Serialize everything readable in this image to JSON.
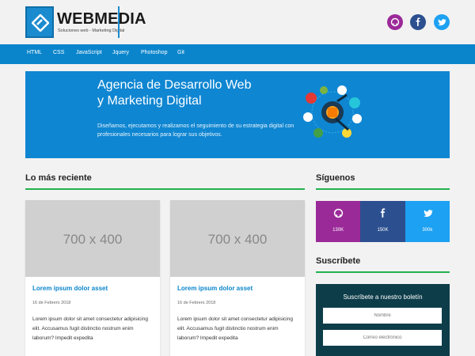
{
  "brand": {
    "name": "WEBMEDIA",
    "tagline": "Soluciones web - Marketing Digital",
    "color": "#1b8bcf"
  },
  "header_social": [
    {
      "icon": "github-icon",
      "color": "#9b2a99"
    },
    {
      "icon": "facebook-icon",
      "color": "#2c4f8f"
    },
    {
      "icon": "twitter-icon",
      "color": "#1da1f2"
    }
  ],
  "nav": {
    "items": [
      "HTML",
      "CSS",
      "JavaScript",
      "Jquery",
      "Photoshop",
      "Git"
    ],
    "color": "#0a85cc"
  },
  "hero": {
    "title_line1": "Agencia de Desarrollo Web",
    "title_line2": "y Marketing Digital",
    "text": "Diseñamos, ejecutamos y realizamos el seguimiento de su estrategia digital con profesionales necesarios para lograr sus objetivos."
  },
  "latest": {
    "heading": "Lo más reciente",
    "cards": [
      {
        "image_label": "700 x 400",
        "title": "Lorem ipsum dolor asset",
        "date": "16 de Febrero 2018",
        "text": "Lorem ipsum dolor sit amet consectetur adipisicing elit. Accusamus fugit distinctio nostrum enim laborum? Impedit expedita"
      },
      {
        "image_label": "700 x 400",
        "title": "Lorem ipsum dolor asset",
        "date": "16 de Febrero 2018",
        "text": "Lorem ipsum dolor sit amet consectetur adipisicing elit. Accusamus fugit distinctio nostrum enim laborum? Impedit expedita"
      }
    ]
  },
  "follow": {
    "heading": "Síguenos",
    "items": [
      {
        "icon": "github-icon",
        "count": "130K",
        "color": "#9b2a99"
      },
      {
        "icon": "facebook-icon",
        "count": "150K",
        "color": "#2c4f8f"
      },
      {
        "icon": "twitter-icon",
        "count": "300k",
        "color": "#1da1f2"
      }
    ]
  },
  "subscribe": {
    "heading": "Suscríbete",
    "box_title": "Suscríbete a nuestro boletín",
    "name_placeholder": "Nombre",
    "email_placeholder": "Correo electrónico"
  },
  "accent_green": "#22b24c"
}
